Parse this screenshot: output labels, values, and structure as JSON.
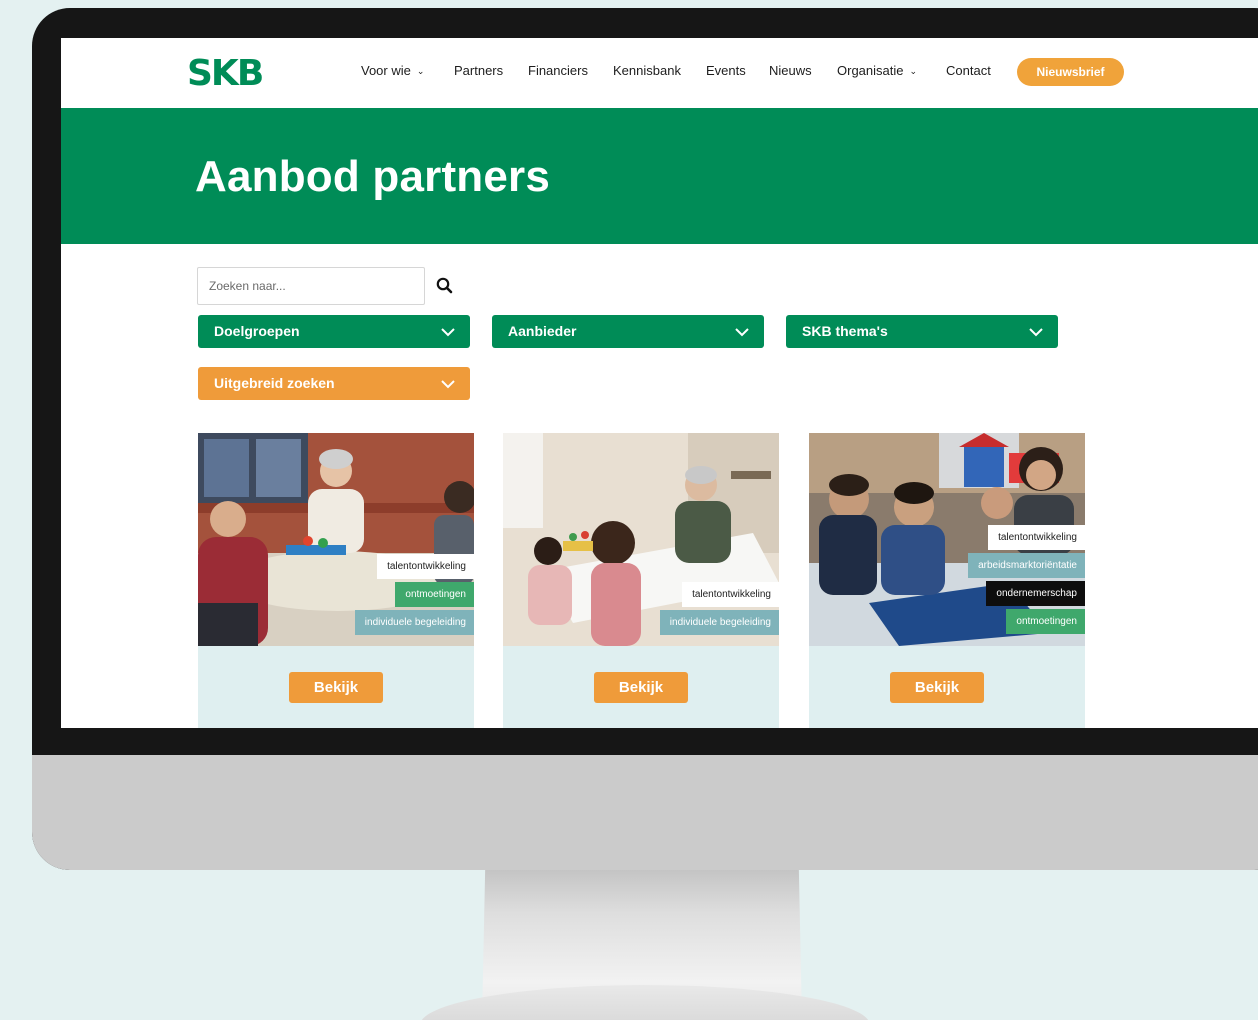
{
  "header": {
    "logo_text": "SKB",
    "nav": [
      {
        "label": "Voor wie",
        "has_dropdown": true
      },
      {
        "label": "Partners",
        "has_dropdown": false
      },
      {
        "label": "Financiers",
        "has_dropdown": false
      },
      {
        "label": "Kennisbank",
        "has_dropdown": false
      },
      {
        "label": "Events",
        "has_dropdown": false
      },
      {
        "label": "Nieuws",
        "has_dropdown": false
      },
      {
        "label": "Organisatie",
        "has_dropdown": true
      },
      {
        "label": "Contact",
        "has_dropdown": false
      }
    ],
    "newsletter_label": "Nieuwsbrief"
  },
  "hero": {
    "title": "Aanbod partners"
  },
  "search": {
    "placeholder": "Zoeken naar..."
  },
  "filters": [
    {
      "label": "Doelgroepen"
    },
    {
      "label": "Aanbieder"
    },
    {
      "label": "SKB thema's"
    },
    {
      "label": "Uitgebreid zoeken"
    }
  ],
  "cards": [
    {
      "tags": [
        "talentontwikkeling",
        "ontmoetingen",
        "individuele begeleiding"
      ],
      "button": "Bekijk"
    },
    {
      "tags": [
        "talentontwikkeling",
        "individuele begeleiding"
      ],
      "button": "Bekijk"
    },
    {
      "tags": [
        "talentontwikkeling",
        "arbeidsmarktoriëntatie",
        "ondernemerschap",
        "ontmoetingen"
      ],
      "button": "Bekijk"
    }
  ],
  "colors": {
    "brand_green": "#008c57",
    "accent_orange": "#ef9b3a",
    "card_bg": "#dfeff0"
  }
}
